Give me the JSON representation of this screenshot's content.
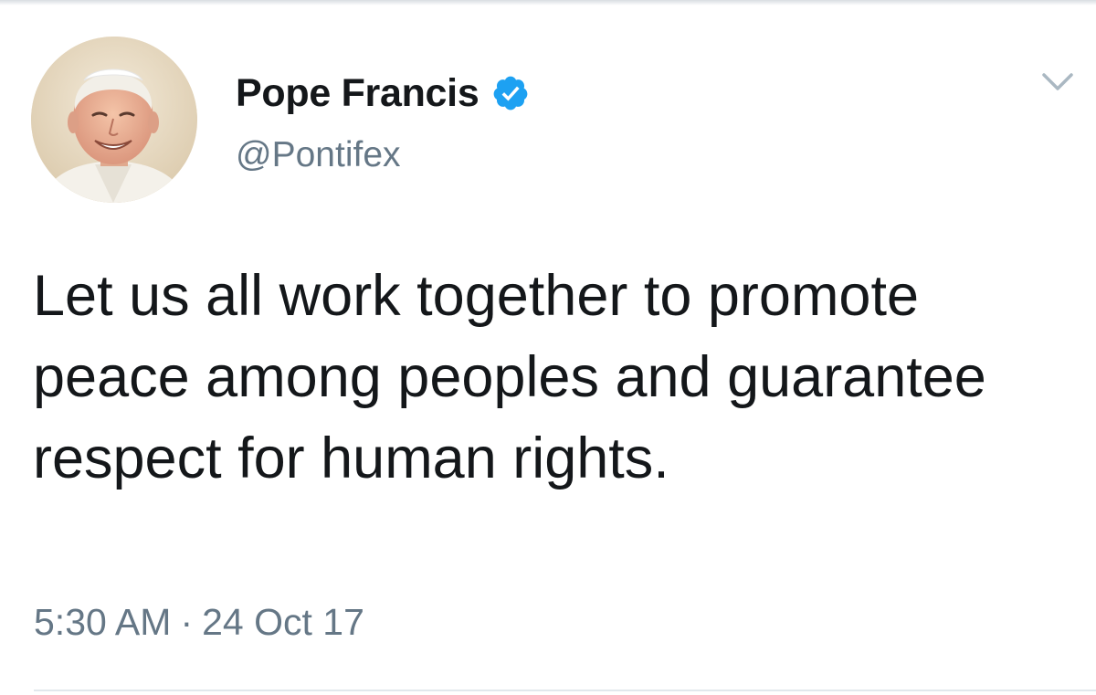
{
  "tweet": {
    "author": {
      "display_name": "Pope Francis",
      "handle": "@Pontifex",
      "verified": true
    },
    "text": "Let us all work together to promote peace among peoples and guarantee respect for human rights.",
    "time": "5:30 AM",
    "separator": "·",
    "date": "24 Oct 17"
  },
  "colors": {
    "verified_badge": "#1da1f2",
    "secondary_text": "#657786",
    "primary_text": "#14171a",
    "divider": "#e1e8ed"
  },
  "icons": {
    "verified": "verified-badge-icon",
    "menu": "chevron-down-icon"
  }
}
